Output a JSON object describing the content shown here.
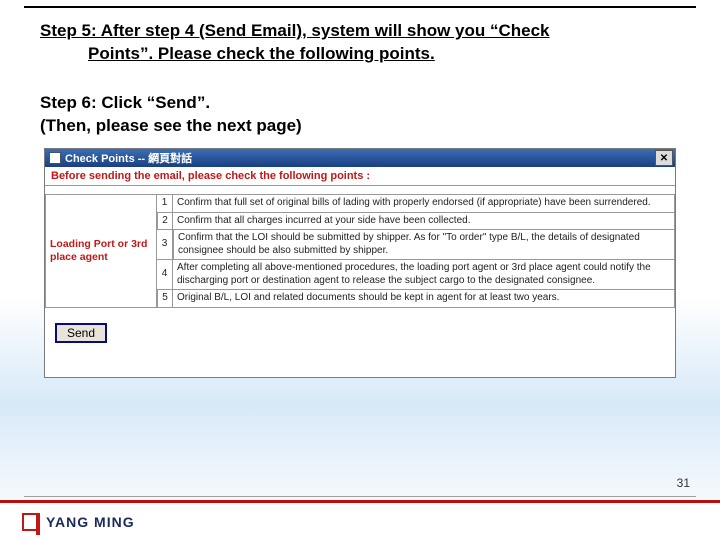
{
  "step5": {
    "line1": "Step 5: After step 4 (Send Email), system will show you “Check",
    "line2": "Points”. Please check the following points."
  },
  "step6": {
    "line1": "Step 6: Click “Send”.",
    "line2": "(Then, please see the next page)"
  },
  "dialog": {
    "title": "Check Points -- 網頁對話",
    "instruction": "Before sending the email, please check the following points :",
    "role": "Loading Port or 3rd place agent",
    "rows": [
      {
        "n": "1",
        "text": "Confirm that full set of original bills of lading with properly endorsed (if appropriate) have been surrendered."
      },
      {
        "n": "2",
        "text": "Confirm that all charges incurred at your side have been collected."
      },
      {
        "n": "3",
        "text": "Confirm that the LOI should be submitted by shipper. As for \"To order\" type B/L, the details of designated consignee should be also submitted by shipper."
      },
      {
        "n": "4",
        "text": "After completing all above-mentioned procedures, the loading port agent or 3rd place agent could notify the discharging port or destination agent to release the subject cargo to the designated consignee."
      },
      {
        "n": "5",
        "text": "Original B/L, LOI and related documents should be kept in agent for at least two years."
      }
    ],
    "send": "Send"
  },
  "footer": {
    "brand": "YANG MING",
    "page": "31"
  }
}
